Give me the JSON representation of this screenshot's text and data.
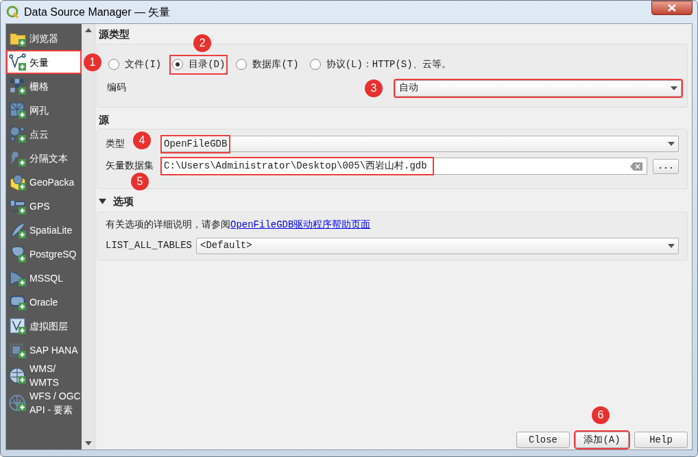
{
  "window": {
    "title": "Data Source Manager — 矢量"
  },
  "sidebar": {
    "items": [
      {
        "label": "浏览器",
        "kind": "folder",
        "selected": false,
        "highlighted": false
      },
      {
        "label": "矢量",
        "kind": "vector",
        "selected": true,
        "highlighted": true,
        "marker": "1"
      },
      {
        "label": "栅格",
        "kind": "raster",
        "selected": false,
        "highlighted": false
      },
      {
        "label": "网孔",
        "kind": "mesh",
        "selected": false,
        "highlighted": false
      },
      {
        "label": "点云",
        "kind": "pointcloud",
        "selected": false,
        "highlighted": false
      },
      {
        "label": "分隔文本",
        "kind": "delimited",
        "selected": false,
        "highlighted": false
      },
      {
        "label": "GeoPacka",
        "kind": "geopackage",
        "selected": false,
        "highlighted": false
      },
      {
        "label": "GPS",
        "kind": "gps",
        "selected": false,
        "highlighted": false
      },
      {
        "label": "SpatiaLite",
        "kind": "spatialite",
        "selected": false,
        "highlighted": false
      },
      {
        "label": "PostgreSQ",
        "kind": "postgres",
        "selected": false,
        "highlighted": false
      },
      {
        "label": "MSSQL",
        "kind": "mssql",
        "selected": false,
        "highlighted": false
      },
      {
        "label": "Oracle",
        "kind": "oracle",
        "selected": false,
        "highlighted": false
      },
      {
        "label": "虚拟图层",
        "kind": "virtual",
        "selected": false,
        "highlighted": false
      },
      {
        "label": "SAP HANA",
        "kind": "sap",
        "selected": false,
        "highlighted": false
      },
      {
        "label": "WMS/ WMTS",
        "kind": "wms",
        "selected": false,
        "highlighted": false
      },
      {
        "label": "WFS / OGC API - 要素",
        "kind": "wfs",
        "selected": false,
        "highlighted": false
      }
    ]
  },
  "source_type": {
    "heading": "源类型",
    "options": [
      {
        "label": "文件(I)",
        "selected": false,
        "highlighted": false
      },
      {
        "label": "目录(D)",
        "selected": true,
        "highlighted": true,
        "marker": "2"
      },
      {
        "label": "数据库(T)",
        "selected": false,
        "highlighted": false
      },
      {
        "label": "协议(L)：HTTP(S)、云等。",
        "selected": false,
        "highlighted": false
      }
    ],
    "encoding": {
      "label": "编码",
      "value": "自动",
      "highlighted": true,
      "marker": "3"
    }
  },
  "source": {
    "heading": "源",
    "type": {
      "label": "类型",
      "value": "OpenFileGDB",
      "highlighted": true,
      "marker": "4"
    },
    "dataset": {
      "label": "矢量数据集",
      "value": "C:\\Users\\Administrator\\Desktop\\005\\西岩山村.gdb",
      "highlighted": true,
      "marker": "5",
      "browse": "..."
    }
  },
  "options": {
    "heading": "选项",
    "expanded": true,
    "help_text": "有关选项的详细说明，请参阅",
    "help_link": "OpenFileGDB驱动程序帮助页面",
    "fields": [
      {
        "label": "LIST_ALL_TABLES",
        "value": "<Default>"
      }
    ]
  },
  "buttons": [
    {
      "label": "Close",
      "highlighted": false
    },
    {
      "label": "添加(A)",
      "highlighted": true,
      "marker": "6"
    },
    {
      "label": "Help",
      "highlighted": false
    }
  ]
}
